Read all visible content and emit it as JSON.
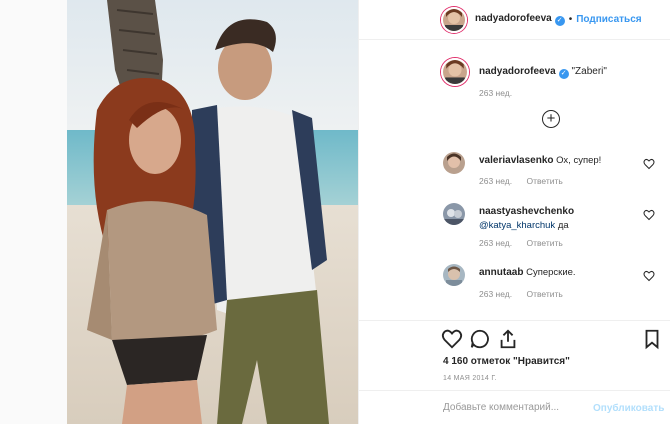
{
  "post": {
    "author": "nadyadorofeeva",
    "follow_label": "Подписаться",
    "dot": "•",
    "caption_text": "\"Zaberi\"",
    "caption_time": "263 нед.",
    "likes_text": "4 160 отметок \"Нравится\"",
    "date_text": "14 МАЯ 2014 Г."
  },
  "comments": [
    {
      "user": "valeriavlasenko",
      "text": "Ох, супер!",
      "time": "263 нед.",
      "reply": "Ответить"
    },
    {
      "user": "naastyashevchenko",
      "mention": "@katya_kharchuk",
      "text": " да",
      "time": "263 нед.",
      "reply": "Ответить"
    },
    {
      "user": "annutaab",
      "text": "Суперские.",
      "time": "263 нед.",
      "reply": "Ответить"
    }
  ],
  "add_comment": {
    "placeholder": "Добавьте комментарий...",
    "publish_label": "Опубликовать"
  },
  "icons": {
    "verified": "verified-badge-icon",
    "load_more": "plus-circle-icon",
    "like": "heart-icon",
    "comment": "comment-bubble-icon",
    "share": "share-arrow-icon",
    "save": "bookmark-icon"
  },
  "colors": {
    "accent": "#3897f0",
    "muted": "#8e8e8e",
    "border": "#efefef"
  }
}
